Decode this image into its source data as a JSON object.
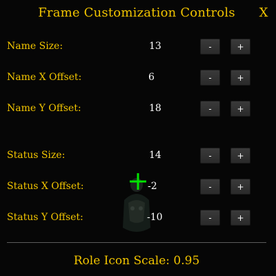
{
  "window": {
    "title": "Frame Customization Controls",
    "close_label": "X"
  },
  "controls": [
    {
      "label": "Name Size:",
      "value": "13",
      "minus": "-",
      "plus": "+"
    },
    {
      "label": "Name X Offset:",
      "value": "6",
      "minus": "-",
      "plus": "+"
    },
    {
      "label": "Name Y Offset:",
      "value": "18",
      "minus": "-",
      "plus": "+"
    },
    {
      "label": "Status Size:",
      "value": "14",
      "minus": "-",
      "plus": "+"
    },
    {
      "label": "Status X Offset:",
      "value": "-2",
      "minus": "-",
      "plus": "+"
    },
    {
      "label": "Status Y Offset:",
      "value": "-10",
      "minus": "-",
      "plus": "+"
    }
  ],
  "footer": {
    "role_icon_scale": "Role Icon Scale: 0.95"
  },
  "colors": {
    "label_gold": "#f2c500",
    "value_white": "#ffffff",
    "cursor_green": "#00ff00"
  },
  "icons": {
    "cursor": "crosshair-icon",
    "background": "character-figure"
  }
}
